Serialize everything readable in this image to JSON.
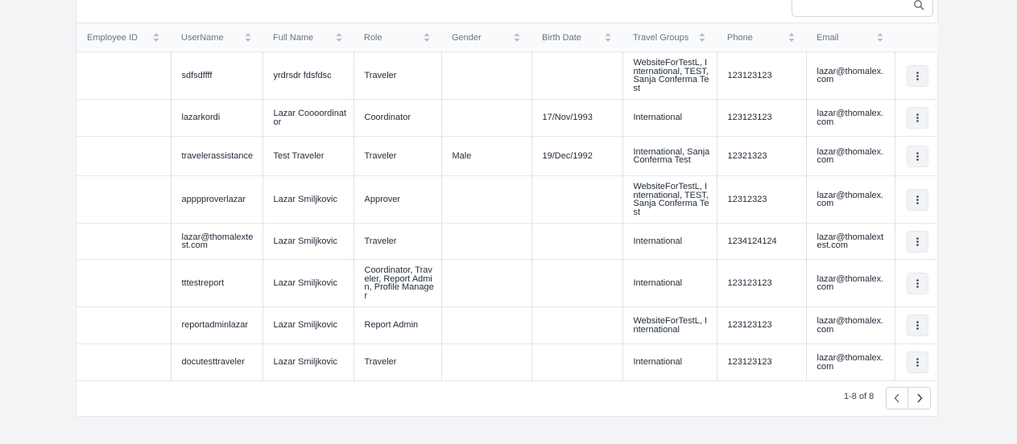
{
  "search": {
    "placeholder": ""
  },
  "table": {
    "columns": [
      {
        "label": "Employee ID",
        "sortable": true
      },
      {
        "label": "UserName",
        "sortable": true
      },
      {
        "label": "Full Name",
        "sortable": true
      },
      {
        "label": "Role",
        "sortable": true
      },
      {
        "label": "Gender",
        "sortable": true
      },
      {
        "label": "Birth Date",
        "sortable": true
      },
      {
        "label": "Travel Groups",
        "sortable": true
      },
      {
        "label": "Phone",
        "sortable": true
      },
      {
        "label": "Email",
        "sortable": true
      },
      {
        "label": "",
        "sortable": false
      }
    ],
    "rows": [
      {
        "employee_id": "",
        "username": "sdfsdffff",
        "full_name": "yrdrsdr fdsfdsc",
        "role": "Traveler",
        "gender": "",
        "birth_date": "",
        "travel_groups": "WebsiteForTestL, International, TEST, Sanja Conferma Test",
        "phone": "123123123",
        "email": "lazar@thomalex.com"
      },
      {
        "employee_id": "",
        "username": "lazarkordi",
        "full_name": "Lazar Coooordinator",
        "role": "Coordinator",
        "gender": "",
        "birth_date": "17/Nov/1993",
        "travel_groups": "International",
        "phone": "123123123",
        "email": "lazar@thomalex.com"
      },
      {
        "employee_id": "",
        "username": "travelerassistance",
        "full_name": "Test Traveler",
        "role": "Traveler",
        "gender": "Male",
        "birth_date": "19/Dec/1992",
        "travel_groups": "International, Sanja Conferma Test",
        "phone": "12321323",
        "email": "lazar@thomalex.com"
      },
      {
        "employee_id": "",
        "username": "apppproverlazar",
        "full_name": "Lazar Smiljkovic",
        "role": "Approver",
        "gender": "",
        "birth_date": "",
        "travel_groups": "WebsiteForTestL, International, TEST, Sanja Conferma Test",
        "phone": "12312323",
        "email": "lazar@thomalex.com"
      },
      {
        "employee_id": "",
        "username": "lazar@thomalextest.com",
        "full_name": "Lazar Smiljkovic",
        "role": "Traveler",
        "gender": "",
        "birth_date": "",
        "travel_groups": "International",
        "phone": "1234124124",
        "email": "lazar@thomalextest.com"
      },
      {
        "employee_id": "",
        "username": "tttestreport",
        "full_name": "Lazar Smiljkovic",
        "role": "Coordinator, Traveler, Report Admin, Profile Manager",
        "gender": "",
        "birth_date": "",
        "travel_groups": "International",
        "phone": "123123123",
        "email": "lazar@thomalex.com"
      },
      {
        "employee_id": "",
        "username": "reportadminlazar",
        "full_name": "Lazar Smiljkovic",
        "role": "Report Admin",
        "gender": "",
        "birth_date": "",
        "travel_groups": "WebsiteForTestL, International",
        "phone": "123123123",
        "email": "lazar@thomalex.com"
      },
      {
        "employee_id": "",
        "username": "docutesttraveler",
        "full_name": "Lazar Smiljkovic",
        "role": "Traveler",
        "gender": "",
        "birth_date": "",
        "travel_groups": "International",
        "phone": "123123123",
        "email": "lazar@thomalex.com"
      }
    ]
  },
  "pagination": {
    "range_text": "1-8 of 8"
  },
  "colors": {
    "background": "#f3f4f6",
    "card": "#ffffff",
    "header": "#f9fafb",
    "border": "#e5e7eb",
    "text": "#1f2937",
    "muted": "#6b7280"
  }
}
